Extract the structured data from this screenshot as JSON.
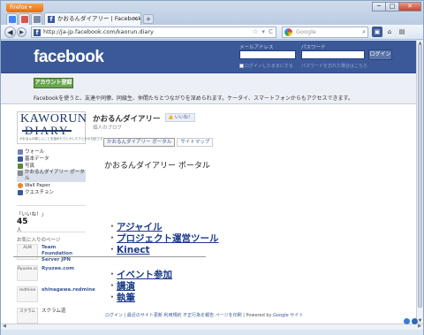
{
  "browser": {
    "app_button": "Firefox ▾",
    "tab_title": "かおるんダイアリー | Facebook",
    "tab_close": "×",
    "new_tab": "+",
    "url": "http://ja-jp.facebook.com/kaorun.diary",
    "url_right_icons": "☆ ▾ C",
    "search_placeholder": "Google",
    "window_min": "─",
    "window_max": "□",
    "window_close": "✕"
  },
  "fb_header": {
    "logo": "facebook",
    "email_label": "メールアドレス",
    "password_label": "パスワード",
    "login_button": "ログイン",
    "keep_logged_in": "ログインしたままにする",
    "forgot_password": "パスワードを忘れた場合はこちら"
  },
  "promo": {
    "register_button": "アカウント登録",
    "text": "Facebookを使うと、友達や同僚、同級生、仲間たちとつながりを深められます。ケータイ、スマートフォンからもアクセスできます。"
  },
  "sidebar": {
    "logo_line1": "KAWORUN",
    "logo_line2": "DIARY",
    "logo_tagline": "かおるんの新しいことを始めたりとかしたりとかの日記です",
    "items": [
      {
        "label": "ウォール",
        "icon": "wall-icon",
        "color": "#6d84b4"
      },
      {
        "label": "基本データ",
        "icon": "info-icon",
        "color": "#3b5998"
      },
      {
        "label": "写真",
        "icon": "photo-icon",
        "color": "#5b8a3a"
      },
      {
        "label": "かおるんダイアリー ポータル",
        "icon": "page-icon",
        "color": "#888888",
        "active": true
      },
      {
        "label": "Wall Paper",
        "icon": "paper-icon",
        "color": "#e08a2e"
      },
      {
        "label": "クエスチョン",
        "icon": "question-icon",
        "color": "#3b5998"
      }
    ],
    "likes_label": "「いいね！」",
    "likes_count": "45",
    "likes_unit": "人",
    "favorites_title": "お気に入りのページ",
    "favorites": [
      {
        "name": "Team Foundation Server JPN",
        "thumb": "ALM"
      },
      {
        "name": "Ryuzee.com",
        "thumb": "Ryuzee.com"
      },
      {
        "name": "shinagawa.redmine",
        "thumb": "redmine"
      },
      {
        "name": "スクラム道",
        "thumb": "スクラム"
      }
    ]
  },
  "main": {
    "page_title": "かおるんダイアリー",
    "like_button": "いいね！",
    "page_subtitle": "個人のブログ",
    "tabs": [
      "かおるんダイアリー ポータル",
      "サイトマップ"
    ],
    "heading": "かおるんダイアリー ポータル",
    "links_group1": [
      "アジャイル",
      "プロジェクト運営ツール",
      "Kinect"
    ],
    "links_group2": [
      "イベント参加",
      "講演",
      "執筆"
    ],
    "footer_links": [
      "ログイン",
      "最近のサイト更新",
      "利用規約",
      "不正行為を報告",
      "ページを印刷"
    ],
    "footer_powered": "Powered by",
    "footer_google": "Google サイト"
  }
}
